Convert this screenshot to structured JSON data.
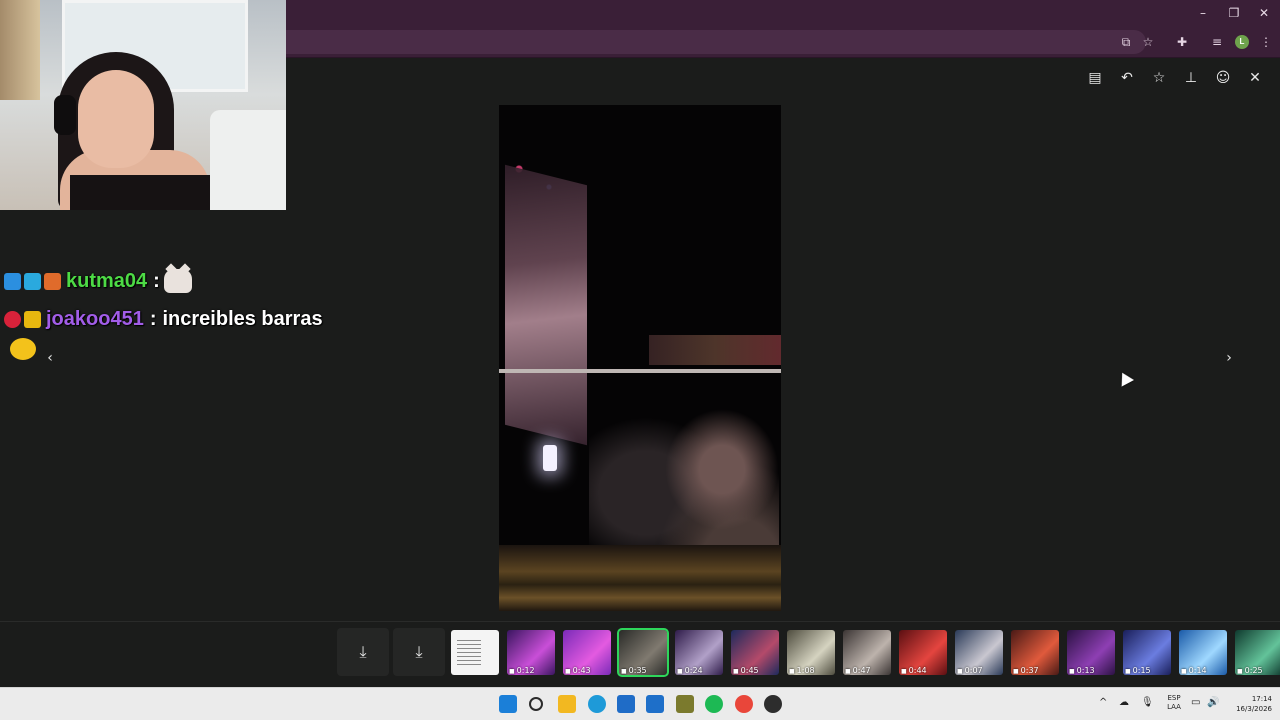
{
  "window": {
    "minimize": "–",
    "restore": "❐",
    "close": "✕"
  },
  "toolbar": {
    "icons": [
      "install-app-icon",
      "bookmark-star-icon",
      "extensions-icon",
      "media-controls-icon",
      "profile-avatar",
      "more-menu-icon"
    ],
    "profile_initial": "L",
    "glyphs": {
      "install": "⧉",
      "star": "☆",
      "ext": "✚",
      "media": "≡",
      "more": "⋮"
    }
  },
  "viewer_actions": {
    "glyphs": {
      "caption": "▤",
      "reply": "↶",
      "star": "☆",
      "pin": "⊥",
      "emoji": "☺",
      "close": "✕"
    }
  },
  "chat": {
    "messages": [
      {
        "user": "kutma04",
        "separator": ":",
        "text": "",
        "badges": [
          "#2b8fe0",
          "#2aa9de",
          "#e06b2b"
        ]
      },
      {
        "user": "joakoo451",
        "separator": ":",
        "text": "increibles barras",
        "badges": [
          "#d8223a",
          "#e7b70f"
        ]
      }
    ]
  },
  "nav": {
    "prev": "‹",
    "next": "›"
  },
  "filmstrip": {
    "download_glyph": "⤓",
    "thumbs": [
      {
        "duration": "",
        "kind": "document",
        "colors": [
          "#f4f4f4",
          "#f4f4f4"
        ]
      },
      {
        "duration": "0:12",
        "kind": "video",
        "colors": [
          "#3a1660",
          "#c94fd8"
        ]
      },
      {
        "duration": "0:43",
        "kind": "video",
        "colors": [
          "#7a2bb8",
          "#e35ae0"
        ]
      },
      {
        "duration": "0:35",
        "kind": "video",
        "colors": [
          "#2a2b28",
          "#807a70"
        ],
        "selected": true
      },
      {
        "duration": "0:24",
        "kind": "video",
        "colors": [
          "#2f1c4a",
          "#b1a0c8"
        ]
      },
      {
        "duration": "0:45",
        "kind": "video",
        "colors": [
          "#1d2a5c",
          "#b44a6a"
        ]
      },
      {
        "duration": "1:08",
        "kind": "video",
        "colors": [
          "#4e4c3e",
          "#d5d3c0"
        ]
      },
      {
        "duration": "0:47",
        "kind": "video",
        "colors": [
          "#3b3534",
          "#bdb3ac"
        ]
      },
      {
        "duration": "0:44",
        "kind": "video",
        "colors": [
          "#5b0f12",
          "#e4453f"
        ]
      },
      {
        "duration": "0:07",
        "kind": "video",
        "colors": [
          "#2a3a58",
          "#c9c7d0"
        ]
      },
      {
        "duration": "0:37",
        "kind": "video",
        "colors": [
          "#4a1a16",
          "#e05a3c"
        ]
      },
      {
        "duration": "0:13",
        "kind": "video",
        "colors": [
          "#2c1244",
          "#8e3fb3"
        ]
      },
      {
        "duration": "0:15",
        "kind": "video",
        "colors": [
          "#1a1f5a",
          "#6b7de0"
        ]
      },
      {
        "duration": "0:14",
        "kind": "video",
        "colors": [
          "#1a5aa8",
          "#9fd8ff"
        ]
      },
      {
        "duration": "0:25",
        "kind": "video",
        "colors": [
          "#0f3a2e",
          "#63c39a"
        ]
      }
    ]
  },
  "taskbar": {
    "apps": [
      {
        "name": "start-icon",
        "color": "#1b7fd8"
      },
      {
        "name": "search-icon",
        "color": "#2b2b2b"
      },
      {
        "name": "file-explorer-icon",
        "color": "#f2b821"
      },
      {
        "name": "edge-icon",
        "color": "#1e9ad8"
      },
      {
        "name": "store-icon",
        "color": "#1f6cc7"
      },
      {
        "name": "outlook-icon",
        "color": "#1e6fc9"
      },
      {
        "name": "twitch-studio-icon",
        "color": "#7b7a2d"
      },
      {
        "name": "spotify-icon",
        "color": "#1db954"
      },
      {
        "name": "chrome-icon",
        "color": "#e9463a"
      },
      {
        "name": "obs-icon",
        "color": "#2d2d2d"
      }
    ],
    "tray_glyphs": {
      "chevron": "^",
      "onedrive": "☁",
      "mic": "🎙",
      "display": "▭",
      "volume": "🔊"
    },
    "language": {
      "line1": "ESP",
      "line2": "LAA"
    },
    "clock": {
      "time": "17:14",
      "date": "16/3/2026"
    }
  }
}
